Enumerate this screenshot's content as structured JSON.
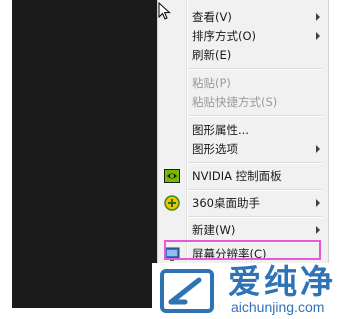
{
  "menu": {
    "items": [
      {
        "label": "查看(V)",
        "submenu": true,
        "disabled": false,
        "icon": ""
      },
      {
        "label": "排序方式(O)",
        "submenu": true,
        "disabled": false,
        "icon": ""
      },
      {
        "label": "刷新(E)",
        "submenu": false,
        "disabled": false,
        "icon": ""
      },
      {
        "label": "粘贴(P)",
        "submenu": false,
        "disabled": true,
        "icon": ""
      },
      {
        "label": "粘贴快捷方式(S)",
        "submenu": false,
        "disabled": true,
        "icon": ""
      },
      {
        "label": "图形属性...",
        "submenu": false,
        "disabled": false,
        "icon": ""
      },
      {
        "label": "图形选项",
        "submenu": true,
        "disabled": false,
        "icon": ""
      },
      {
        "label": "NVIDIA 控制面板",
        "submenu": false,
        "disabled": false,
        "icon": "nvidia-icon"
      },
      {
        "label": "360桌面助手",
        "submenu": true,
        "disabled": false,
        "icon": "360-desktop-assistant-icon"
      },
      {
        "label": "新建(W)",
        "submenu": true,
        "disabled": false,
        "icon": ""
      },
      {
        "label": "屏幕分辨率(C)",
        "submenu": false,
        "disabled": false,
        "icon": "screen-resolution-icon"
      }
    ],
    "highlight_color": "#e65ad9"
  },
  "watermark": {
    "name": "爱纯净",
    "url": "aichunjing.com",
    "color": "#2f73b5"
  }
}
